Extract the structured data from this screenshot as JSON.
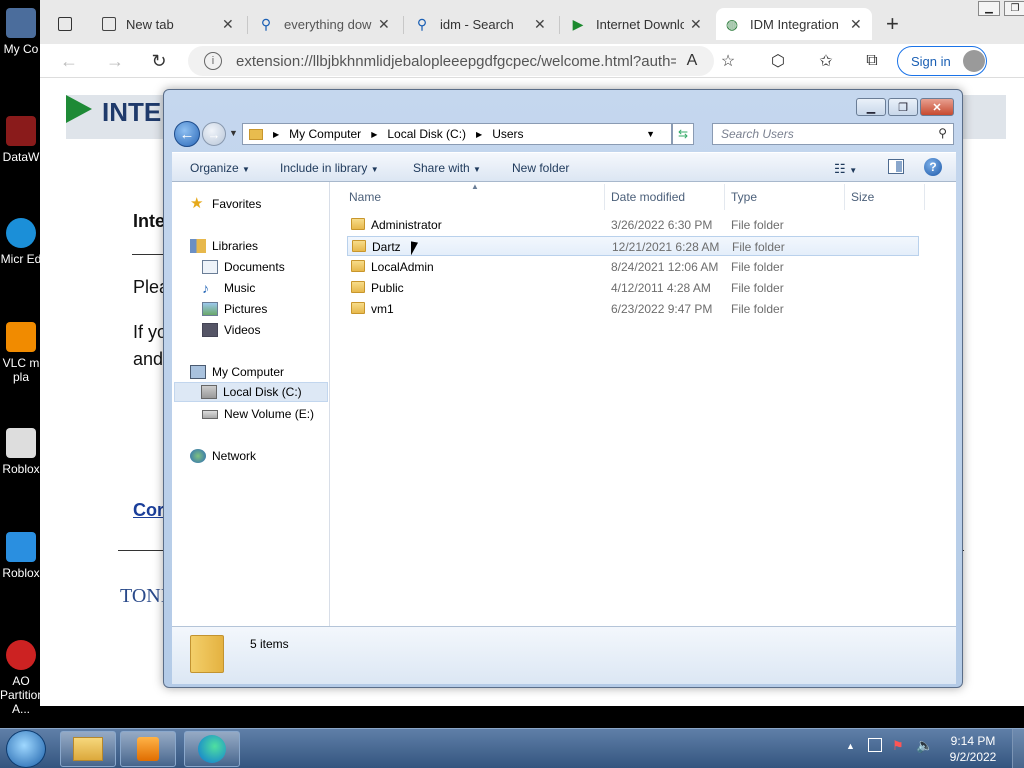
{
  "desktop": {
    "icons": [
      "My Co",
      "DataW",
      "Micr Ed",
      "VLC m pla",
      "Roblox",
      "Roblox",
      "AO Partition A..."
    ]
  },
  "browser": {
    "tabs": [
      {
        "label": "New tab"
      },
      {
        "label": "everything down"
      },
      {
        "label": "idm - Search"
      },
      {
        "label": "Internet Downlo"
      },
      {
        "label": "IDM Integration"
      }
    ],
    "address": "extension://llbjbkhnmlidjebalopleeepgdfgcpec/welcome.html?auth=...",
    "signin_label": "Sign in",
    "page": {
      "logo_text": "INTE",
      "heading_frag": "Inte",
      "para1_frag": "Plea",
      "para2_frag": "If yo",
      "para3_frag": "and",
      "link_frag": "Cor",
      "footer_frag": "TONI"
    }
  },
  "explorer": {
    "breadcrumb": [
      "My Computer",
      "Local Disk (C:)",
      "Users"
    ],
    "search_placeholder": "Search Users",
    "toolbar": {
      "organize": "Organize",
      "include": "Include in library",
      "share": "Share with",
      "new_folder": "New folder"
    },
    "nav": {
      "favorites": "Favorites",
      "libraries": "Libraries",
      "documents": "Documents",
      "music": "Music",
      "pictures": "Pictures",
      "videos": "Videos",
      "computer": "My Computer",
      "local_disk": "Local Disk (C:)",
      "new_volume": "New Volume (E:)",
      "network": "Network"
    },
    "columns": {
      "name": "Name",
      "date": "Date modified",
      "type": "Type",
      "size": "Size"
    },
    "files": [
      {
        "name": "Administrator",
        "date": "3/26/2022 6:30 PM",
        "type": "File folder"
      },
      {
        "name": "Dartz",
        "date": "12/21/2021 6:28 AM",
        "type": "File folder"
      },
      {
        "name": "LocalAdmin",
        "date": "8/24/2021 12:06 AM",
        "type": "File folder"
      },
      {
        "name": "Public",
        "date": "4/12/2011 4:28 AM",
        "type": "File folder"
      },
      {
        "name": "vm1",
        "date": "6/23/2022 9:47 PM",
        "type": "File folder"
      }
    ],
    "status": "5 items"
  },
  "taskbar": {
    "time": "9:14 PM",
    "date": "9/2/2022"
  }
}
